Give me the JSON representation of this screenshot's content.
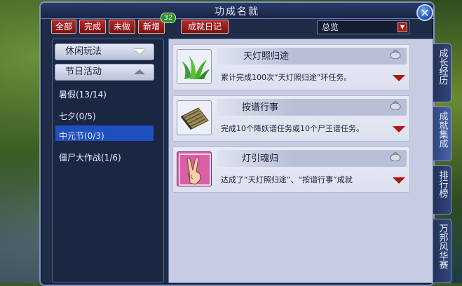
{
  "window": {
    "title": "功成名就"
  },
  "filters": {
    "all": "全部",
    "done": "完成",
    "undone": "未做",
    "new": "新增",
    "new_count": "32",
    "diary": "成就日记"
  },
  "overview_select": {
    "value": "总览"
  },
  "categories": [
    {
      "label": "休闲玩法",
      "state": "collapsed"
    },
    {
      "label": "节日活动",
      "state": "expanded"
    }
  ],
  "subitems": [
    {
      "label": "暑假(13/14)",
      "selected": false
    },
    {
      "label": "七夕(0/5)",
      "selected": false
    },
    {
      "label": "中元节(0/3)",
      "selected": true
    },
    {
      "label": "僵尸大作战(1/6)",
      "selected": false
    }
  ],
  "achievements": [
    {
      "name": "天灯照归途",
      "desc": "累计完成100次“天灯照归途”环任务。",
      "icon": "grass-icon"
    },
    {
      "name": "按谱行事",
      "desc": "完成10个降妖谱任务或10个尸王谱任务。",
      "icon": "scroll-icon"
    },
    {
      "name": "灯引魂归",
      "desc": "达成了“天灯照归途”、“按谱行事”成就",
      "icon": "victory-hand-icon"
    }
  ],
  "side_tabs": [
    "成长经历",
    "成就集成",
    "排行榜",
    "万邦风华赛"
  ],
  "colors": {
    "accent_red": "#b52a2a",
    "selected_blue": "#1f4fc0",
    "panel": "#1f2c47"
  }
}
